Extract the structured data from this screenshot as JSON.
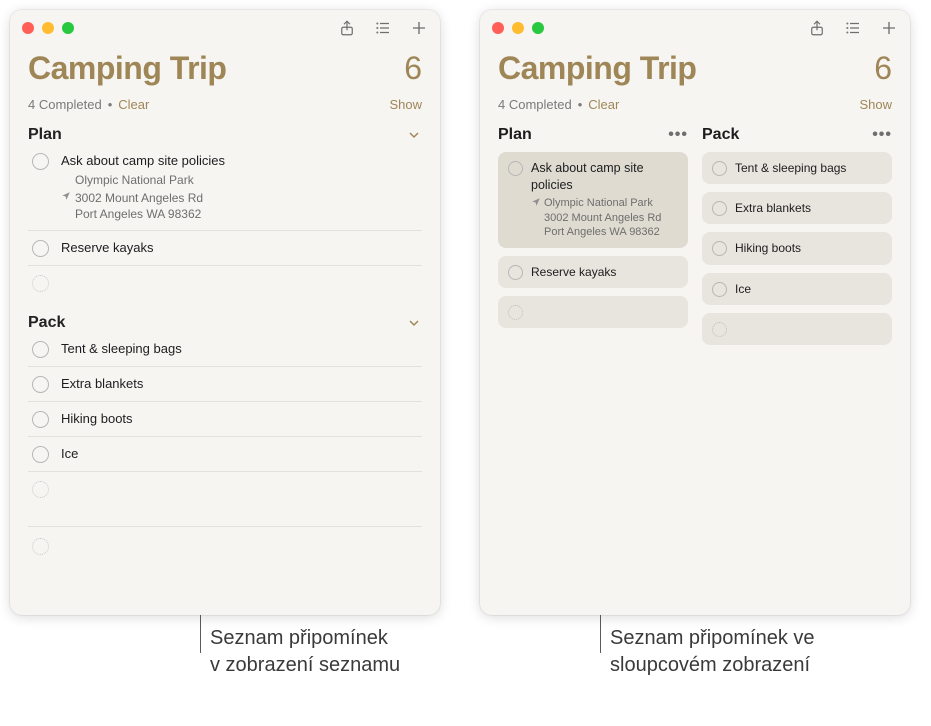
{
  "list": {
    "title": "Camping Trip",
    "count": "6",
    "completed_text": "4 Completed",
    "dot": "•",
    "clear": "Clear",
    "show": "Show"
  },
  "sections": {
    "plan": {
      "title": "Plan",
      "items": [
        {
          "title": "Ask about camp site policies",
          "location_name": "Olympic National Park",
          "location_addr1": "3002 Mount Angeles Rd",
          "location_addr2": "Port Angeles WA 98362"
        },
        {
          "title": "Reserve kayaks"
        }
      ]
    },
    "pack": {
      "title": "Pack",
      "items": [
        {
          "title": "Tent & sleeping bags"
        },
        {
          "title": "Extra blankets"
        },
        {
          "title": "Hiking boots"
        },
        {
          "title": "Ice"
        }
      ]
    }
  },
  "captions": {
    "left": "Seznam připomínek v zobrazení seznamu",
    "right": "Seznam připomínek ve sloupcovém zobrazení"
  },
  "more": "•••"
}
